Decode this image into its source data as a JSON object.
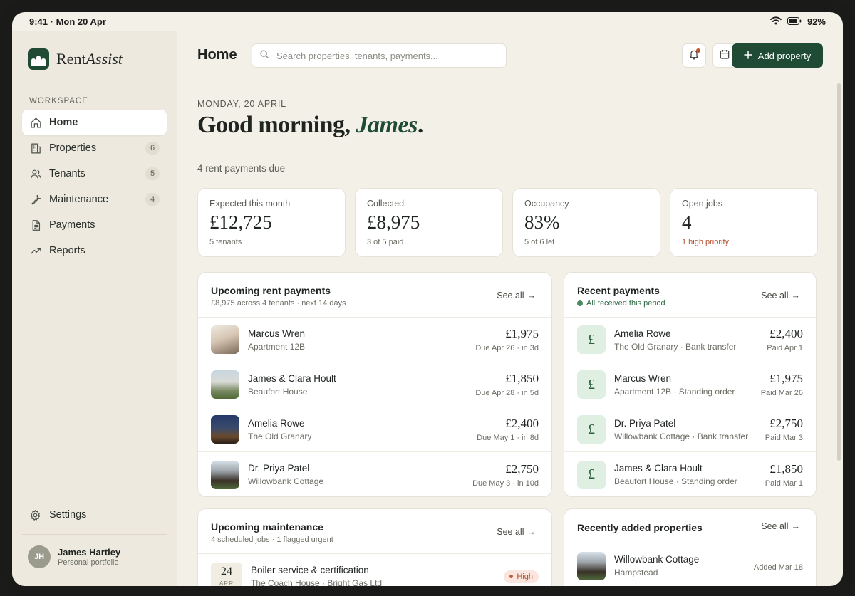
{
  "status": {
    "time": "9:41 · Mon 20 Apr",
    "battery": "92%"
  },
  "brand": {
    "name_plain": "Rent",
    "name_italic": "Assist"
  },
  "sidebar": {
    "section_label": "WORKSPACE",
    "items": [
      {
        "label": "Home",
        "icon": "home-icon",
        "badge": ""
      },
      {
        "label": "Properties",
        "icon": "building-icon",
        "badge": "6"
      },
      {
        "label": "Tenants",
        "icon": "users-icon",
        "badge": "5"
      },
      {
        "label": "Maintenance",
        "icon": "wrench-icon",
        "badge": "4"
      },
      {
        "label": "Payments",
        "icon": "document-icon",
        "badge": ""
      },
      {
        "label": "Reports",
        "icon": "trend-icon",
        "badge": ""
      }
    ],
    "settings_label": "Settings",
    "user": {
      "initials": "JH",
      "name": "James Hartley",
      "subtitle": "Personal portfolio"
    }
  },
  "header": {
    "title": "Home",
    "search_placeholder": "Search properties, tenants, payments...",
    "add_button": "Add property",
    "accent": "#1f4a34"
  },
  "overview": {
    "date": "MONDAY, 20 APRIL",
    "greeting": "Good morning,",
    "greeting_name": "James",
    "greeting_end": ".",
    "due_text": "4 rent payments due"
  },
  "stats": [
    {
      "label": "Expected this month",
      "value": "£12,725",
      "sub": "5 tenants"
    },
    {
      "label": "Collected",
      "value": "£8,975",
      "sub": "3 of 5 paid"
    },
    {
      "label": "Occupancy",
      "value": "83%",
      "sub": "5 of 6 let"
    },
    {
      "label": "Open jobs",
      "value": "4",
      "sub": "1 high priority"
    }
  ],
  "upcoming": {
    "title": "Upcoming rent payments",
    "subtitle": "£8,975 across 4 tenants · next 14 days",
    "see_all": "See all",
    "rows": [
      {
        "name": "Marcus Wren",
        "property": "Apartment 12B",
        "amount": "£1,975",
        "due": "Due Apr 26 · in 3d"
      },
      {
        "name": "James & Clara Hoult",
        "property": "Beaufort House",
        "amount": "£1,850",
        "due": "Due Apr 28 · in 5d"
      },
      {
        "name": "Amelia Rowe",
        "property": "The Old Granary",
        "amount": "£2,400",
        "due": "Due May 1 · in 8d"
      },
      {
        "name": "Dr. Priya Patel",
        "property": "Willowbank Cottage",
        "amount": "£2,750",
        "due": "Due May 3 · in 10d"
      }
    ]
  },
  "recent": {
    "title": "Recent payments",
    "subtitle": "All received this period",
    "see_all": "See all",
    "rows": [
      {
        "symbol": "£",
        "name": "Amelia Rowe",
        "detail": "The Old Granary · Bank transfer",
        "amount": "£2,400",
        "paid": "Paid Apr 1"
      },
      {
        "symbol": "£",
        "name": "Marcus Wren",
        "detail": "Apartment 12B · Standing order",
        "amount": "£1,975",
        "paid": "Paid Mar 26"
      },
      {
        "symbol": "£",
        "name": "Dr. Priya Patel",
        "detail": "Willowbank Cottage · Bank transfer",
        "amount": "£2,750",
        "paid": "Paid Mar 3"
      },
      {
        "symbol": "£",
        "name": "James & Clara Hoult",
        "detail": "Beaufort House · Standing order",
        "amount": "£1,850",
        "paid": "Paid Mar 1"
      }
    ]
  },
  "maintenance": {
    "title": "Upcoming maintenance",
    "subtitle": "4 scheduled jobs · 1 flagged urgent",
    "see_all": "See all",
    "rows": [
      {
        "day": "24",
        "month": "APR",
        "title": "Boiler service & certification",
        "detail": "The Coach House · Bright Gas Ltd",
        "priority": "High"
      }
    ]
  },
  "recently_added": {
    "title": "Recently added properties",
    "see_all": "See all",
    "rows": [
      {
        "name": "Willowbank Cottage",
        "location": "Hampstead",
        "added": "Added Mar 18"
      }
    ]
  }
}
